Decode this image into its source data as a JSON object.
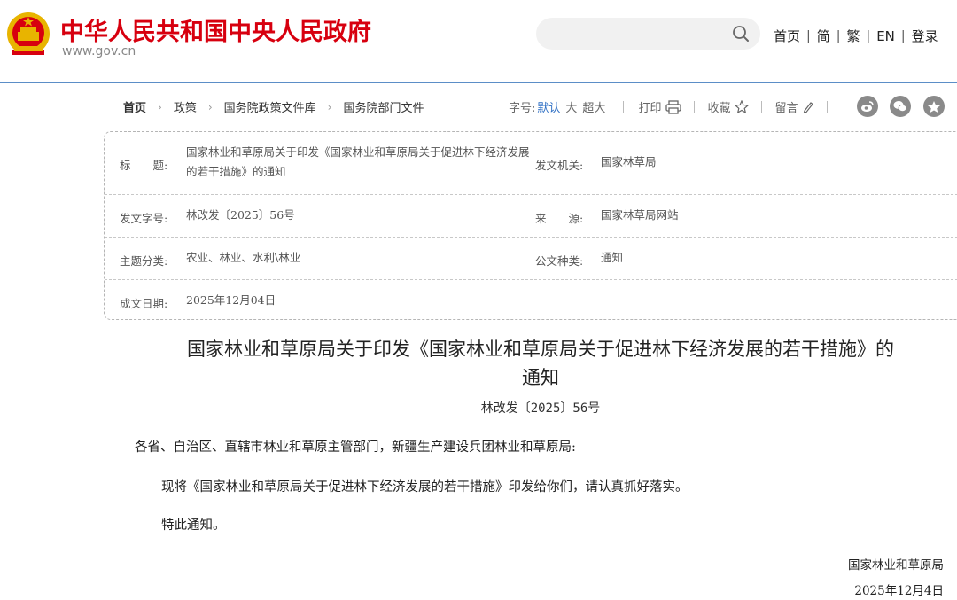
{
  "header": {
    "site_title": "中华人民共和国中央人民政府",
    "site_url": "www.gov.cn",
    "search": {
      "placeholder": ""
    },
    "nav": [
      "首页",
      "简",
      "繁",
      "EN",
      "登录"
    ],
    "nav_separator": "|"
  },
  "breadcrumb": {
    "items": [
      "首页",
      "政策",
      "国务院政策文件库",
      "国务院部门文件"
    ],
    "separator": "›"
  },
  "toolbar": {
    "font_size_label": "字号:",
    "font_default": "默认",
    "font_large": "大",
    "font_xlarge": "超大",
    "print": "打印",
    "favorite": "收藏",
    "comment": "留言"
  },
  "meta": {
    "title_label": "标　　题:",
    "title_value": "国家林业和草原局关于印发《国家林业和草原局关于促进林下经济发展的若干措施》的通知",
    "issuer_label": "发文机关:",
    "issuer_value": "国家林草局",
    "doc_no_label": "发文字号:",
    "doc_no_value": "林改发〔2025〕56号",
    "source_label": "来　　源:",
    "source_value": "国家林草局网站",
    "topic_label": "主题分类:",
    "topic_value": "农业、林业、水利\\林业",
    "type_label": "公文种类:",
    "type_value": "通知",
    "date_label": "成文日期:",
    "date_value": "2025年12月04日"
  },
  "document": {
    "title_line1": "国家林业和草原局关于印发《国家林业和草原局关于促进林下经济发展的若干措施》的",
    "title_line2": "通知",
    "number": "林改发〔2025〕56号",
    "salutation": "各省、自治区、直辖市林业和草原主管部门，新疆生产建设兵团林业和草原局:",
    "paragraph": "现将《国家林业和草原局关于促进林下经济发展的若干措施》印发给你们，请认真抓好落实。",
    "closing": "特此通知。",
    "signer": "国家林业和草原局",
    "sign_date": "2025年12月4日"
  },
  "colors": {
    "brand_red": "#d7000f",
    "link_blue": "#2e6fc4",
    "header_line": "#5b8ec7"
  },
  "icons": [
    "national-emblem",
    "search-icon",
    "printer-icon",
    "star-icon",
    "pencil-icon",
    "weibo-icon",
    "wechat-icon",
    "qzone-icon"
  ]
}
